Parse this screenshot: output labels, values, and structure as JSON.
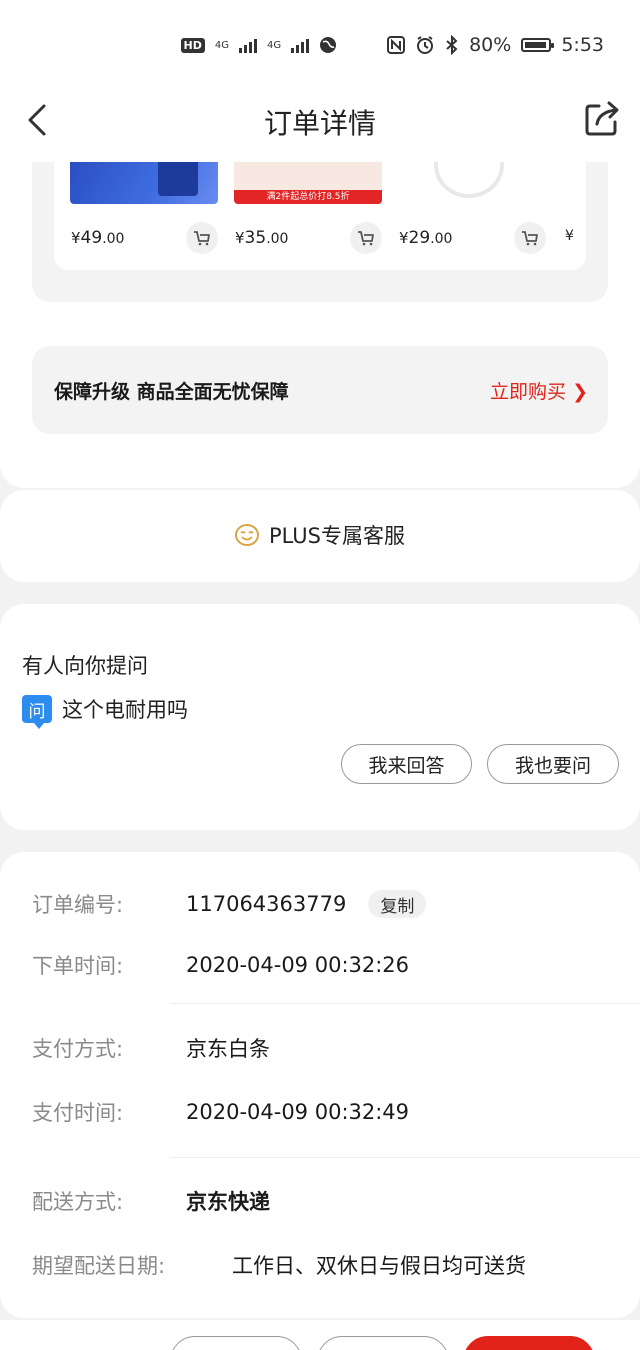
{
  "status_bar": {
    "hd_label": "HD",
    "network1": "4G",
    "network2": "4G",
    "battery": "80%",
    "time": "5:53",
    "battery_level": 0.8
  },
  "nav": {
    "title": "订单详情",
    "back_icon": "chevron-left-icon",
    "share_icon": "share-icon"
  },
  "recommendations": {
    "products": [
      {
        "price_symbol": "¥",
        "price_int": "49",
        "price_dec": ".00",
        "cart_icon": "cart-icon"
      },
      {
        "price_symbol": "¥",
        "price_int": "35",
        "price_dec": ".00",
        "cart_icon": "cart-icon",
        "promo": "满2件起总价打8.5折"
      },
      {
        "price_symbol": "¥",
        "price_int": "29",
        "price_dec": ".00",
        "cart_icon": "cart-icon"
      }
    ],
    "next_price_peek": "¥"
  },
  "guarantee": {
    "title": "保障升级  商品全面无忧保障",
    "buy_label": "立即购买 ❯"
  },
  "service": {
    "label": "PLUS专属客服",
    "icon": "smile-face-icon"
  },
  "qa": {
    "title": "有人向你提问",
    "badge": "问",
    "question": "这个电耐用吗",
    "answer_button": "我来回答",
    "ask_button": "我也要问"
  },
  "order_info": {
    "order_no_label": "订单编号:",
    "order_no": "117064363779",
    "copy_label": "复制",
    "order_time_label": "下单时间:",
    "order_time": "2020-04-09 00:32:26",
    "pay_method_label": "支付方式:",
    "pay_method": "京东白条",
    "pay_time_label": "支付时间:",
    "pay_time": "2020-04-09 00:32:49",
    "delivery_label": "配送方式:",
    "delivery": "京东快递",
    "expected_date_label": "期望配送日期:",
    "expected_date": "工作日、双休日与假日均可送货"
  },
  "colors": {
    "accent_red": "#e2231a",
    "question_blue": "#2d8cf0",
    "service_gold": "#d9a441"
  }
}
